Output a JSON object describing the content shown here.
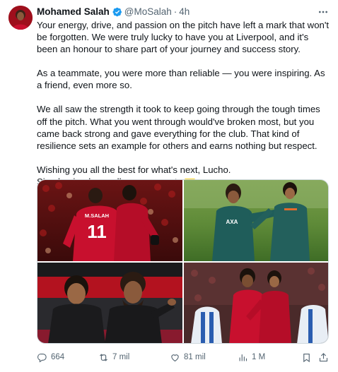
{
  "tweet": {
    "author_name": "Mohamed Salah",
    "handle": "@MoSalah",
    "separator": "·",
    "time": "4h",
    "paragraphs": [
      "Your energy, drive, and passion on the pitch have left a mark that won't be forgotten. We were truly lucky to have you at Liverpool, and it's been an honour to share part of your journey and success story.",
      "As a teammate, you were more than reliable — you were inspiring. As a friend, even more so.",
      "We all saw the strength it took to keep going through the tough times off the pitch. What you went through would've broken most, but you came back strong and gave everything for the club. That kind of resilience sets an example for others and earns nothing but respect.",
      "Wishing you all the best for what's next, Lucho.",
      "Siga haciendo orgullosa a su gente"
    ],
    "flag_emoji": "colombia-flag",
    "media": [
      {
        "name": "photo-celebration-shirt-11",
        "shirt_text": "M.SALAH",
        "shirt_number": "11"
      },
      {
        "name": "photo-training-embrace",
        "kit_text": "AXA"
      },
      {
        "name": "photo-bench-smiling"
      },
      {
        "name": "photo-match-hug"
      }
    ]
  },
  "actions": {
    "replies": "664",
    "reposts": "7 mil",
    "likes": "81 mil",
    "views": "1 M"
  },
  "icons": [
    "verified-badge-icon",
    "more-options-icon",
    "reply-icon",
    "repost-icon",
    "like-icon",
    "views-icon",
    "bookmark-icon",
    "share-icon"
  ],
  "colors": {
    "text": "#0f1419",
    "secondary": "#536471",
    "verified": "#1d9bf0",
    "border": "#cfd9de",
    "liverpool_red": "#c8102e"
  }
}
